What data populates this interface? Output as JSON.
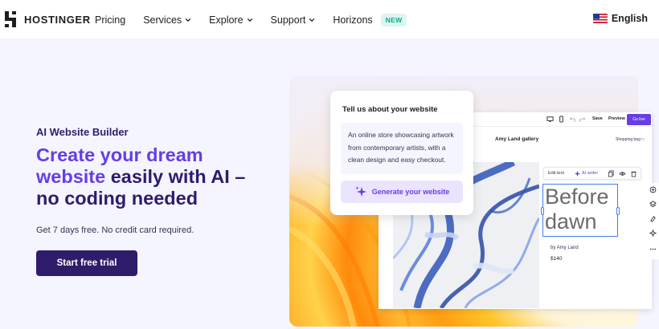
{
  "brand": {
    "name": "HOSTINGER"
  },
  "nav": {
    "items": [
      {
        "label": "Pricing",
        "has_dropdown": false
      },
      {
        "label": "Services",
        "has_dropdown": true
      },
      {
        "label": "Explore",
        "has_dropdown": true
      },
      {
        "label": "Support",
        "has_dropdown": true
      },
      {
        "label": "Horizons",
        "has_dropdown": false,
        "badge": "NEW"
      }
    ],
    "language": {
      "label": "English",
      "icon": "us-flag-icon"
    }
  },
  "hero": {
    "tag": "AI Website Builder",
    "title_accent": "Create your dream website",
    "title_rest": " easily with AI – no coding needed",
    "subtitle": "Get 7 days free. No credit card required.",
    "cta": "Start free trial"
  },
  "prompt_card": {
    "title": "Tell us about your website",
    "text": "An online store showcasing artwork from contemporary artists, with a clean design and easy checkout.",
    "button": "Generate your website",
    "button_icon": "sparkle-icon"
  },
  "editor": {
    "toolbar": {
      "save": "Save",
      "preview": "Preview",
      "go_live": "Go live"
    },
    "site_name": "Amy Land gallery",
    "shopping_bag": "Shopping bag",
    "edit_bar": {
      "edit_text": "Edit text",
      "ai_writer": "AI writer"
    },
    "heading_line1": "Before",
    "heading_line2": "dawn",
    "byline": "by Amy Land",
    "price": "$140"
  },
  "colors": {
    "primary": "#673de6",
    "dark": "#2f1c6a",
    "background": "#f4f5ff",
    "badge_bg": "#def4f0",
    "badge_text": "#00b090"
  }
}
